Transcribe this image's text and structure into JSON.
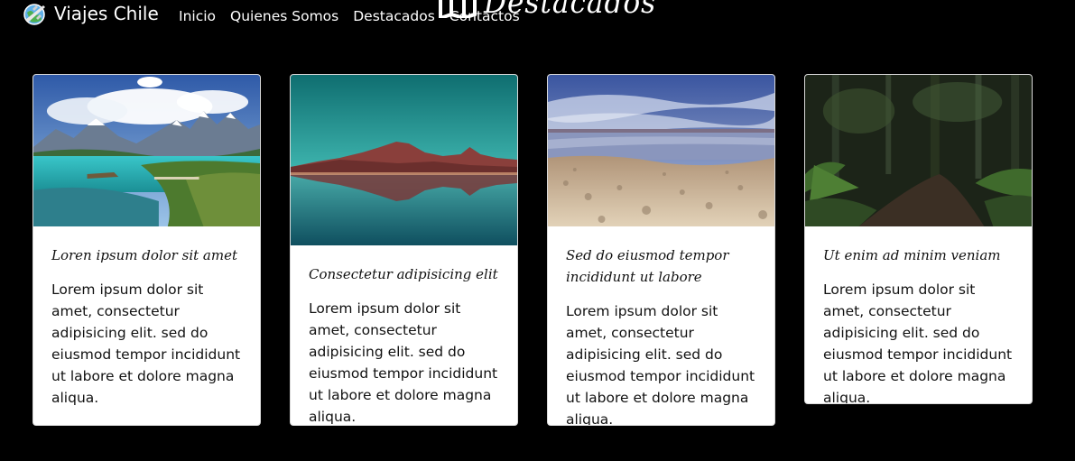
{
  "navbar": {
    "brand": "Viajes Chile",
    "links": [
      "Inicio",
      "Quienes Somos",
      "Destacados",
      "Contactos"
    ]
  },
  "section": {
    "heading": "Destacados"
  },
  "cards": [
    {
      "title": "Loren ipsum dolor sit amet",
      "text": "Lorem ipsum dolor sit amet, consectetur adipisicing elit. sed do eiusmod tempor incididunt ut labore et dolore magna aliqua."
    },
    {
      "title": "Consectetur adipisicing elit",
      "text": "Lorem ipsum dolor sit amet, consectetur adipisicing elit. sed do eiusmod tempor incididunt ut labore et dolore magna aliqua."
    },
    {
      "title": "Sed do eiusmod tempor incididunt ut labore",
      "text": "Lorem ipsum dolor sit amet, consectetur adipisicing elit. sed do eiusmod tempor incididunt ut labore et dolore magna aliqua."
    },
    {
      "title": "Ut enim ad minim veniam",
      "text": "Lorem ipsum dolor sit amet, consectetur adipisicing elit. sed do eiusmod tempor incididunt ut labore et dolore magna aliqua."
    }
  ],
  "colors": {
    "background": "#000000",
    "card": "#ffffff",
    "nav_text": "#ffffff"
  }
}
